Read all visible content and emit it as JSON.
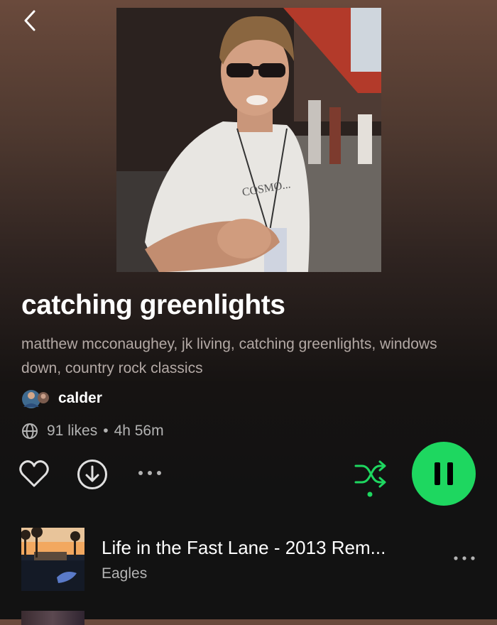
{
  "header": {
    "back_icon": "chevron-left-icon"
  },
  "playlist": {
    "title": "catching greenlights",
    "description": "matthew mcconaughey, jk living, catching greenlights, windows down, country rock classics",
    "owner": "calder",
    "likes": "91 likes",
    "separator": "•",
    "duration": "4h 56m"
  },
  "actions": {
    "like_icon": "heart-outline-icon",
    "download_icon": "download-circle-icon",
    "more_icon": "more-horizontal-icon",
    "shuffle_icon": "shuffle-icon",
    "play_icon": "pause-icon"
  },
  "colors": {
    "accent": "#1ed760",
    "text_secondary": "#b3b3b3",
    "background": "#121212"
  },
  "tracks": [
    {
      "title": "Life in the Fast Lane - 2013 Rem...",
      "artist": "Eagles"
    }
  ]
}
